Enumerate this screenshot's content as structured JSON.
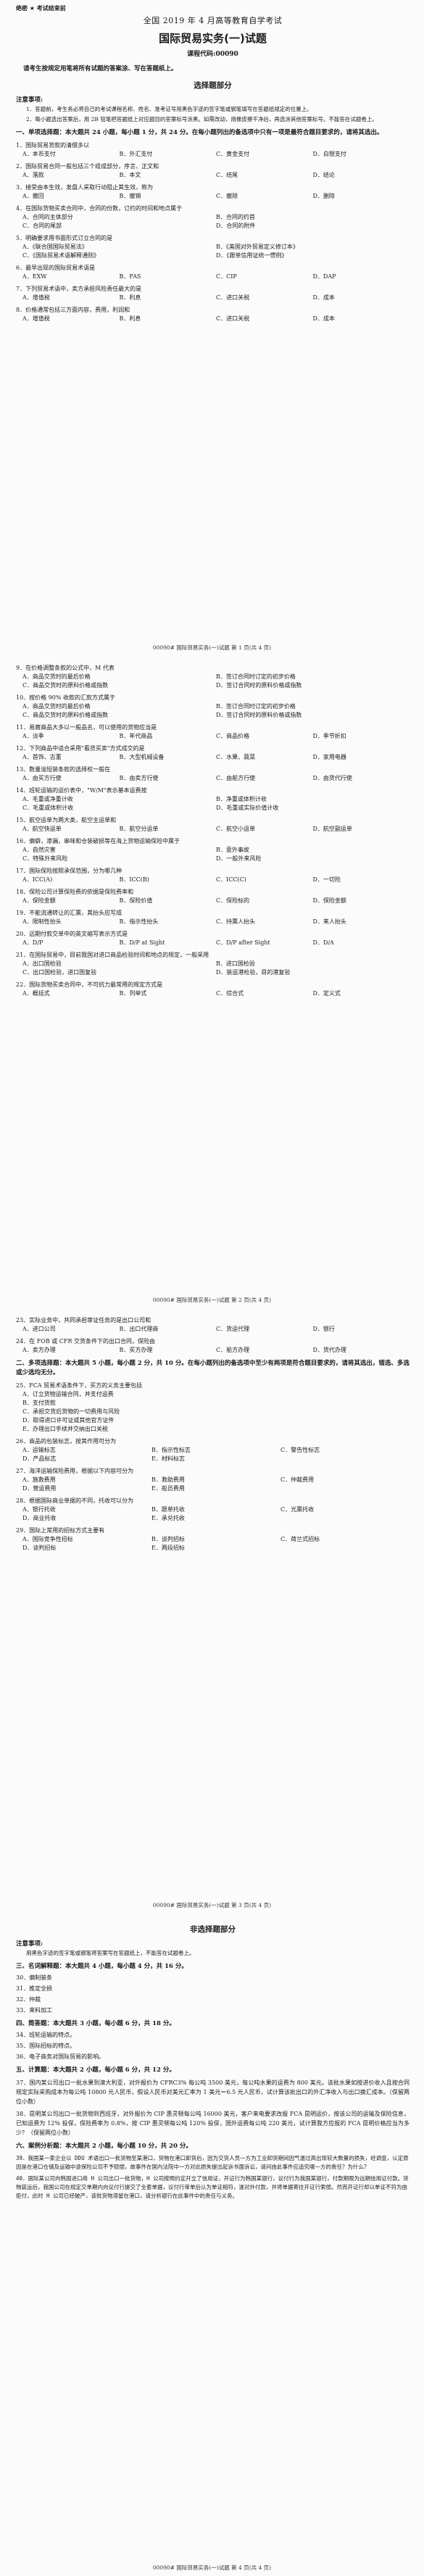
{
  "header": {
    "confidential": "绝密 ★ 考试结束前",
    "exam": "全国 2019 年 4 月高等教育自学考试",
    "subject": "国际贸易实务(一)试题",
    "code": "课程代码:00090",
    "notice": "请考生按规定用笔将所有试题的答案涂、写在答题纸上。"
  },
  "sections": {
    "choice": "选择题部分",
    "nonchoice": "非选择题部分"
  },
  "attention": {
    "title": "注意事项:",
    "items": [
      "1．答题前，考生务必将自己的考试课程名称、姓名、准考证号用黑色字迹的签字笔或钢笔填写在答题纸规定的位置上。",
      "2．每小题选出答案后，用 2B 铅笔把答题纸上对应题目的答案标号涂黑。如需改动，用橡皮擦干净后，再选涂其他答案标号。不能答在试题卷上。"
    ],
    "title2": "注意事项:",
    "item2": "用黑色字迹的签字笔或钢笔将答案写在答题纸上，不能答在试题卷上。"
  },
  "part1": {
    "title": "一、单项选择题：本大题共 24 小题，每小题 1 分，共 24 分。在每小题列出的备选项中只有一项是最符合题目要求的，请将其选出。",
    "questions": [
      {
        "q": "1．国际贸易货款的清偿多以",
        "o": [
          "A．本币支付",
          "B．外汇支付",
          "C．黄金支付",
          "D．白银支付"
        ]
      },
      {
        "q": "2．国际贸易合同一般包括三个组成部分，序言、正文和",
        "o": [
          "A．落款",
          "B．本文",
          "C．结尾",
          "D．结论"
        ]
      },
      {
        "q": "3．接受由本生效，发盘人采取行动阻止其生效，称为",
        "o": [
          "A．撤回",
          "B．撤销",
          "C．撤除",
          "D．删除"
        ]
      },
      {
        "q": "4．在国际货物买卖合同中，合同的份数，订约的时间和地点属于",
        "o": [
          "A．合同的主体部分",
          "B．合同的约首",
          "C．合同的尾部",
          "D．合同的附件"
        ],
        "two": true
      },
      {
        "q": "5．明确要求用书面形式订立合同的是",
        "o": [
          "A．《联合国国际贸易法》",
          "B．《美国对外贸易定义修订本》",
          "C．《国际贸易术语解释通则》",
          "D．《跟单信用证统一惯例》"
        ],
        "two": true
      },
      {
        "q": "6．最早出现的国际贸易术语是",
        "o": [
          "A．EXW",
          "B．FAS",
          "C．CIP",
          "D．DAP"
        ]
      },
      {
        "q": "7．下列贸易术语中，卖方承担风险责任最大的是",
        "o": [
          "A．增值税",
          "B．利息",
          "C．进口关税",
          "D．成本"
        ]
      },
      {
        "q": "8．价格通常包括三方面内容，费用，利润和",
        "o": [
          "A．增值税",
          "B．利息",
          "C．进口关税",
          "D．成本"
        ]
      }
    ],
    "footer1": "00090# 国际贸易实务(一)试题 第 1 页(共 4 页)",
    "questions2": [
      {
        "q": "9．在价格调整条款的公式中，M 代表",
        "o": [
          "A．商品交货时的最后价格",
          "B．签订合同时订定的初步价格",
          "C．商品交货时的原料价格或指数",
          "D．签订合同时的原料价格或指数"
        ],
        "two": true
      },
      {
        "q": "10．按价格 90% 收款的汇款方式属于",
        "o": [
          "A．商品交货时的最后价格",
          "B．签订合同时订定的初步价格",
          "C．商品交货时的原料价格或指数",
          "D．签订合同时的原料价格或指数"
        ],
        "two": true
      },
      {
        "q": "11．易腐商品大多以一般品名，可以使用的货物应当是",
        "o": [
          "A．淡季",
          "B．年代商品",
          "C．商品价格",
          "D．季节折扣"
        ]
      },
      {
        "q": "12．下列商品中适合采用\"看货买卖\"方式成交的是",
        "o": [
          "A．首饰、古董",
          "B．大型机械设备",
          "C．水果、蔬菜",
          "D．家用电器"
        ]
      },
      {
        "q": "13．数量溢短装条款的选择权一般在",
        "o": [
          "A．由买方行使",
          "B．由卖方行使",
          "C．由船方行使",
          "D．由货代行使"
        ]
      },
      {
        "q": "14．班轮运输的运价表中，\"W/M\"表示基本运费按",
        "o": [
          "A．毛重或净重计收",
          "B．净重或体积计收",
          "C．毛重或体积计收",
          "D．毛重或实际价值计收"
        ],
        "two": true
      },
      {
        "q": "15．航空运单为两大类，航空主运单和",
        "o": [
          "A．航空快运单",
          "B．航空分运单",
          "C．航空小运单",
          "D．航空副运单"
        ]
      },
      {
        "q": "16．偏僻，渗漏，串味和仓装破损等在海上货物运输保险中属于",
        "o": [
          "A．自然灾害",
          "B．意外事故",
          "C．特殊外来风险",
          "D．一般外来风险"
        ],
        "two": true
      },
      {
        "q": "17．国际保险按照承保范围，分为哪几种",
        "o": [
          "A．ICC(A)",
          "B．ICC(B)",
          "C．ICC(C)",
          "D．一切险"
        ]
      },
      {
        "q": "18．保险公司计算保险费的依据是保险费率和",
        "o": [
          "A．保险金额",
          "B．保险价值",
          "C．保险标的",
          "D．保险金额"
        ]
      },
      {
        "q": "19．不能流通转让的汇票，其抬头应写成",
        "o": [
          "A．限制性抬头",
          "B．指示性抬头",
          "C．持票人抬头",
          "D．来人抬头"
        ]
      },
      {
        "q": "20．远期付款交单中的英文缩写表示方式是",
        "o": [
          "A．D/P",
          "B．D/P at Sight",
          "C．D/P after Sight",
          "D．D/A"
        ]
      },
      {
        "q": "21．在国际贸易中，目前我国对进口商品检验时间和地点的规定，一般采用",
        "o": [
          "A．出口国检验",
          "B．进口国检验",
          "C．出口国检验，进口国复验",
          "D．装运港检验，目的港复验"
        ],
        "two": true
      },
      {
        "q": "22．国际货物买卖合同中，不可抗力最常用的规定方式是",
        "o": [
          "A．概括式",
          "B．列举式",
          "C．综合式",
          "D．定义式"
        ]
      }
    ],
    "footer2": "00090# 国际贸易实务(一)试题 第 2 页(共 4 页)",
    "questions3": [
      {
        "q": "23．实际业务中，共同承担审证任务的是出口公司和",
        "o": [
          "A．进口公司",
          "B．出口代理商",
          "C．货运代理",
          "D．银行"
        ]
      },
      {
        "q": "24．在 FOB 或 CFR 交货条件下的出口合同，保险由",
        "o": [
          "A．卖方办理",
          "B．买方办理",
          "C．船方办理",
          "D．货代办理"
        ]
      }
    ]
  },
  "part2": {
    "title": "二、多项选择题：本大题共 5 小题，每小题 2 分，共 10 分。在每小题列出的备选项中至少有两项是符合题目要求的，请将其选出，错选、多选或少选均无分。",
    "questions": [
      {
        "q": "25．FCA 贸易术语条件下，买方的义务主要包括",
        "o": [
          "A．订立货物运输合同，并支付运费",
          "B．支付货款",
          "C．承担交货后货物的一切费用与风险",
          "D．取得进口许可证或其他官方证件",
          "E．办理出口手续并交纳出口关税"
        ],
        "one": true
      },
      {
        "q": "26．商品的包装标志，按其作用可分为",
        "o": [
          "A．运输标志",
          "B．指示性标志",
          "C．警告性标志",
          "D．产品标志",
          "E．材料标志"
        ],
        "three": true
      },
      {
        "q": "27．海洋运输保险费用，根据以下内容可分为",
        "o": [
          "A．施救费用",
          "B．救助费用",
          "C．仲裁费用",
          "D．营运费用",
          "E．船员费用"
        ],
        "three": true
      },
      {
        "q": "28．根据国际商业单据的不同，托收可以分为",
        "o": [
          "A．银行托收",
          "B．跟单托收",
          "C．光票托收",
          "D．商业托收",
          "E．承兑托收"
        ],
        "three": true
      },
      {
        "q": "29．国际上常用的招标方式主要有",
        "o": [
          "A．国际竞争性招标",
          "B．谈判招标",
          "C．荷兰式招标",
          "D．谈判招标",
          "E．两段招标"
        ],
        "three": true
      }
    ],
    "footer3": "00090# 国际贸易实务(一)试题 第 3 页(共 4 页)"
  },
  "part3": {
    "title": "三、名词解释题：本大题共 4 小题，每小题 4 分，共 16 分。",
    "items": [
      "30．偏制装条",
      "31．推定全损",
      "32．仲裁",
      "33．来料加工"
    ]
  },
  "part4": {
    "title": "四、简答题：本大题共 3 小题，每小题 6 分，共 18 分。",
    "items": [
      "34．班轮运输的特点。",
      "35．国际招标的特点。",
      "36．电子商务对国际贸易的影响。"
    ]
  },
  "part5": {
    "title": "五、计算题：本大题共 2 小题，每小题 6 分，共 12 分。",
    "items": [
      "37．国内某公司出口一批水果到澳大利亚，对外报价为 CFRC3% 每公吨 3500 美元，每公吨水果的运费为 800 美元。该批水果如按进价收入且按合同规定实际采购成本为每公吨 10800 元人民币，假设人民币对美元汇率为 1 美元＝6.5 元人民币，试计算该批出口的外汇净收入与出口换汇成本。（保留两位小数）",
      "38．昆明某公司出口一批货物到西班牙，对外报价为 CIP 惠灵顿每公吨 16000 美元，客户来电要求改报 FCA 昆明运价，按该公司的运输及保险信息，已知运费为 12% 投保，保险费率为 0.8%，按 CIP 惠灵顿每公吨 120% 投保，国外运费每公吨 220 美元，试计算我方应报的 FCA 昆明价格应当为多少？（保留两位小数）"
    ]
  },
  "part6": {
    "title": "六、案例分析题：本大题共 2 小题，每小题 10 分，共 20 分。",
    "items": [
      "39．我国某一家企业以 DDU 术语出口一批货物至某港口，货物在港口卸货后，因为交货人员一方为工业卸货期间因气温过高出现较大数量的损失，经调查，认定原因是在港口仓储及运输中途保险公司不予赔偿，故事件在国内法院中一方对此损失提出起诉书面诉讼，请问由此事件应追究哪一方的责任？为什么？",
      "40．国际某公司向韩国进口商 H 公司出口一批货物，H 公司按照约定开立了信用证，开证行为韩国某银行，议付行为我国某银行，付款期限为远期信用证付款。货物装运后，我国公司在规定交单期内向议付行提交了全套单据，议付行审单后认为单证相符，遂对外付款，并将单据寄往开证行索偿。然而开证行却以单证不符为由拒付，此时 H 公司已经破产，该批货物滞留在港口，请分析银行在此事件中的责任与义务。"
    ],
    "footer4": "00090# 国际贸易实务(一)试题 第 4 页(共 4 页)"
  }
}
